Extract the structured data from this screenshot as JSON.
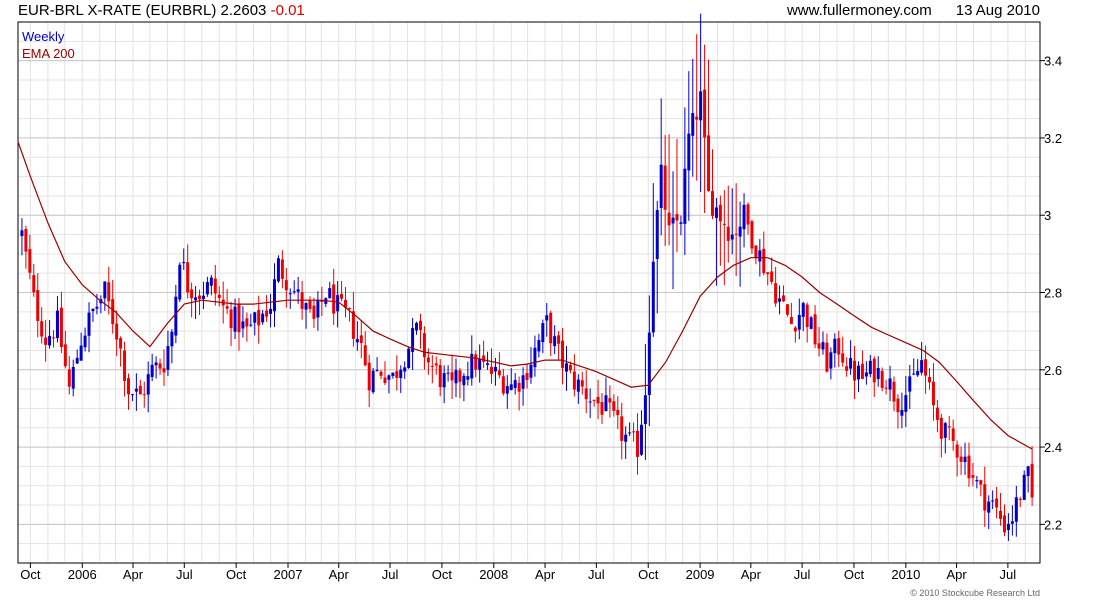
{
  "header": {
    "symbol": "EUR-BRL X-RATE (EURBRL) 2.2603",
    "change": "-0.01",
    "site": "www.fullermoney.com",
    "date": "13 Aug 2010"
  },
  "legend": {
    "weekly": "Weekly",
    "ema": "EMA 200"
  },
  "footer": {
    "copyright": "© 2010 Stockcube Research Ltd"
  },
  "colors": {
    "up": "#0000cc",
    "down": "#ee0000",
    "ema": "#990000",
    "grid": "#e3e3e3"
  },
  "chart_data": {
    "type": "candlestick",
    "ylim": [
      2.1,
      3.5
    ],
    "y_ticks": [
      2.2,
      2.4,
      2.6,
      2.8,
      3.0,
      3.2,
      3.4
    ],
    "y_tick_labels": [
      "2.2",
      "2.4",
      "2.6",
      "2.8",
      "3",
      "3.2",
      "3.4"
    ],
    "x_range": [
      "2005-09-09",
      "2010-08-27"
    ],
    "x_ticks": [
      {
        "label": "Oct",
        "date": "2005-10-01"
      },
      {
        "label": "2006",
        "date": "2006-01-01"
      },
      {
        "label": "Apr",
        "date": "2006-04-01"
      },
      {
        "label": "Jul",
        "date": "2006-07-01"
      },
      {
        "label": "Oct",
        "date": "2006-10-01"
      },
      {
        "label": "2007",
        "date": "2007-01-01"
      },
      {
        "label": "Apr",
        "date": "2007-04-01"
      },
      {
        "label": "Jul",
        "date": "2007-07-01"
      },
      {
        "label": "Oct",
        "date": "2007-10-01"
      },
      {
        "label": "2008",
        "date": "2008-01-01"
      },
      {
        "label": "Apr",
        "date": "2008-04-01"
      },
      {
        "label": "Jul",
        "date": "2008-07-01"
      },
      {
        "label": "Oct",
        "date": "2008-10-01"
      },
      {
        "label": "2009",
        "date": "2009-01-01"
      },
      {
        "label": "Apr",
        "date": "2009-04-01"
      },
      {
        "label": "Jul",
        "date": "2009-07-01"
      },
      {
        "label": "Oct",
        "date": "2009-10-01"
      },
      {
        "label": "2010",
        "date": "2010-01-01"
      },
      {
        "label": "Apr",
        "date": "2010-04-01"
      },
      {
        "label": "Jul",
        "date": "2010-07-01"
      }
    ],
    "close_path": [
      [
        "2005-09-16",
        2.95
      ],
      [
        "2005-10-07",
        2.78
      ],
      [
        "2005-10-28",
        2.68
      ],
      [
        "2005-11-18",
        2.72
      ],
      [
        "2005-12-09",
        2.55
      ],
      [
        "2005-12-30",
        2.68
      ],
      [
        "2006-01-20",
        2.75
      ],
      [
        "2006-02-10",
        2.8
      ],
      [
        "2006-03-03",
        2.7
      ],
      [
        "2006-03-24",
        2.55
      ],
      [
        "2006-04-14",
        2.53
      ],
      [
        "2006-05-05",
        2.6
      ],
      [
        "2006-05-26",
        2.62
      ],
      [
        "2006-06-09",
        2.7
      ],
      [
        "2006-06-23",
        2.9
      ],
      [
        "2006-07-07",
        2.82
      ],
      [
        "2006-07-28",
        2.8
      ],
      [
        "2006-08-18",
        2.82
      ],
      [
        "2006-09-08",
        2.76
      ],
      [
        "2006-09-29",
        2.73
      ],
      [
        "2006-10-20",
        2.7
      ],
      [
        "2006-11-10",
        2.73
      ],
      [
        "2006-12-01",
        2.77
      ],
      [
        "2006-12-15",
        2.87
      ],
      [
        "2007-01-05",
        2.82
      ],
      [
        "2007-01-26",
        2.77
      ],
      [
        "2007-02-16",
        2.72
      ],
      [
        "2007-03-09",
        2.8
      ],
      [
        "2007-03-30",
        2.76
      ],
      [
        "2007-04-20",
        2.73
      ],
      [
        "2007-05-11",
        2.66
      ],
      [
        "2007-05-25",
        2.58
      ],
      [
        "2007-06-15",
        2.6
      ],
      [
        "2007-07-06",
        2.58
      ],
      [
        "2007-07-27",
        2.64
      ],
      [
        "2007-08-17",
        2.7
      ],
      [
        "2007-09-07",
        2.62
      ],
      [
        "2007-09-28",
        2.58
      ],
      [
        "2007-10-19",
        2.55
      ],
      [
        "2007-11-09",
        2.6
      ],
      [
        "2007-11-30",
        2.62
      ],
      [
        "2007-12-21",
        2.6
      ],
      [
        "2008-01-11",
        2.58
      ],
      [
        "2008-02-01",
        2.56
      ],
      [
        "2008-02-22",
        2.58
      ],
      [
        "2008-03-14",
        2.65
      ],
      [
        "2008-04-04",
        2.72
      ],
      [
        "2008-04-25",
        2.64
      ],
      [
        "2008-05-16",
        2.58
      ],
      [
        "2008-06-06",
        2.55
      ],
      [
        "2008-06-27",
        2.52
      ],
      [
        "2008-07-18",
        2.5
      ],
      [
        "2008-08-08",
        2.45
      ],
      [
        "2008-08-29",
        2.41
      ],
      [
        "2008-09-12",
        2.4
      ],
      [
        "2008-09-26",
        2.55
      ],
      [
        "2008-10-10",
        2.9
      ],
      [
        "2008-10-24",
        3.1
      ],
      [
        "2008-11-07",
        2.95
      ],
      [
        "2008-11-28",
        3.0
      ],
      [
        "2008-12-12",
        3.2
      ],
      [
        "2009-01-02",
        3.3
      ],
      [
        "2009-01-16",
        3.05
      ],
      [
        "2009-02-06",
        3.0
      ],
      [
        "2009-02-27",
        2.95
      ],
      [
        "2009-03-20",
        3.0
      ],
      [
        "2009-04-10",
        2.92
      ],
      [
        "2009-05-01",
        2.85
      ],
      [
        "2009-05-22",
        2.78
      ],
      [
        "2009-06-12",
        2.72
      ],
      [
        "2009-07-03",
        2.76
      ],
      [
        "2009-07-24",
        2.68
      ],
      [
        "2009-08-14",
        2.62
      ],
      [
        "2009-09-04",
        2.66
      ],
      [
        "2009-09-25",
        2.6
      ],
      [
        "2009-10-16",
        2.58
      ],
      [
        "2009-11-06",
        2.6
      ],
      [
        "2009-11-27",
        2.58
      ],
      [
        "2009-12-18",
        2.52
      ],
      [
        "2010-01-08",
        2.55
      ],
      [
        "2010-01-29",
        2.62
      ],
      [
        "2010-02-19",
        2.5
      ],
      [
        "2010-03-12",
        2.43
      ],
      [
        "2010-04-02",
        2.4
      ],
      [
        "2010-04-23",
        2.35
      ],
      [
        "2010-05-14",
        2.28
      ],
      [
        "2010-06-04",
        2.25
      ],
      [
        "2010-06-25",
        2.2
      ],
      [
        "2010-07-09",
        2.22
      ],
      [
        "2010-07-23",
        2.28
      ],
      [
        "2010-08-06",
        2.32
      ],
      [
        "2010-08-13",
        2.26
      ]
    ],
    "ema": [
      [
        "2005-09-09",
        3.19
      ],
      [
        "2005-10-01",
        3.1
      ],
      [
        "2005-11-01",
        2.98
      ],
      [
        "2005-12-01",
        2.88
      ],
      [
        "2006-01-01",
        2.82
      ],
      [
        "2006-02-01",
        2.78
      ],
      [
        "2006-03-01",
        2.75
      ],
      [
        "2006-04-01",
        2.7
      ],
      [
        "2006-05-01",
        2.66
      ],
      [
        "2006-06-01",
        2.72
      ],
      [
        "2006-07-01",
        2.77
      ],
      [
        "2006-08-01",
        2.78
      ],
      [
        "2006-09-01",
        2.775
      ],
      [
        "2006-10-01",
        2.77
      ],
      [
        "2006-11-01",
        2.77
      ],
      [
        "2006-12-01",
        2.775
      ],
      [
        "2007-01-01",
        2.78
      ],
      [
        "2007-02-01",
        2.78
      ],
      [
        "2007-03-01",
        2.78
      ],
      [
        "2007-04-01",
        2.775
      ],
      [
        "2007-05-01",
        2.74
      ],
      [
        "2007-06-01",
        2.7
      ],
      [
        "2007-07-01",
        2.68
      ],
      [
        "2007-08-01",
        2.66
      ],
      [
        "2007-09-01",
        2.645
      ],
      [
        "2007-10-01",
        2.64
      ],
      [
        "2007-11-01",
        2.635
      ],
      [
        "2007-12-01",
        2.63
      ],
      [
        "2008-01-01",
        2.62
      ],
      [
        "2008-02-01",
        2.61
      ],
      [
        "2008-03-01",
        2.615
      ],
      [
        "2008-04-01",
        2.625
      ],
      [
        "2008-05-01",
        2.625
      ],
      [
        "2008-06-01",
        2.61
      ],
      [
        "2008-07-01",
        2.595
      ],
      [
        "2008-08-01",
        2.575
      ],
      [
        "2008-09-01",
        2.555
      ],
      [
        "2008-10-01",
        2.56
      ],
      [
        "2008-11-01",
        2.62
      ],
      [
        "2008-12-01",
        2.7
      ],
      [
        "2009-01-01",
        2.79
      ],
      [
        "2009-02-01",
        2.84
      ],
      [
        "2009-03-01",
        2.87
      ],
      [
        "2009-04-01",
        2.89
      ],
      [
        "2009-05-01",
        2.89
      ],
      [
        "2009-06-01",
        2.87
      ],
      [
        "2009-07-01",
        2.84
      ],
      [
        "2009-08-01",
        2.8
      ],
      [
        "2009-09-01",
        2.77
      ],
      [
        "2009-10-01",
        2.74
      ],
      [
        "2009-11-01",
        2.71
      ],
      [
        "2009-12-01",
        2.69
      ],
      [
        "2010-01-01",
        2.67
      ],
      [
        "2010-02-01",
        2.65
      ],
      [
        "2010-03-01",
        2.62
      ],
      [
        "2010-04-01",
        2.57
      ],
      [
        "2010-05-01",
        2.52
      ],
      [
        "2010-06-01",
        2.47
      ],
      [
        "2010-07-01",
        2.43
      ],
      [
        "2010-08-13",
        2.395
      ]
    ]
  }
}
